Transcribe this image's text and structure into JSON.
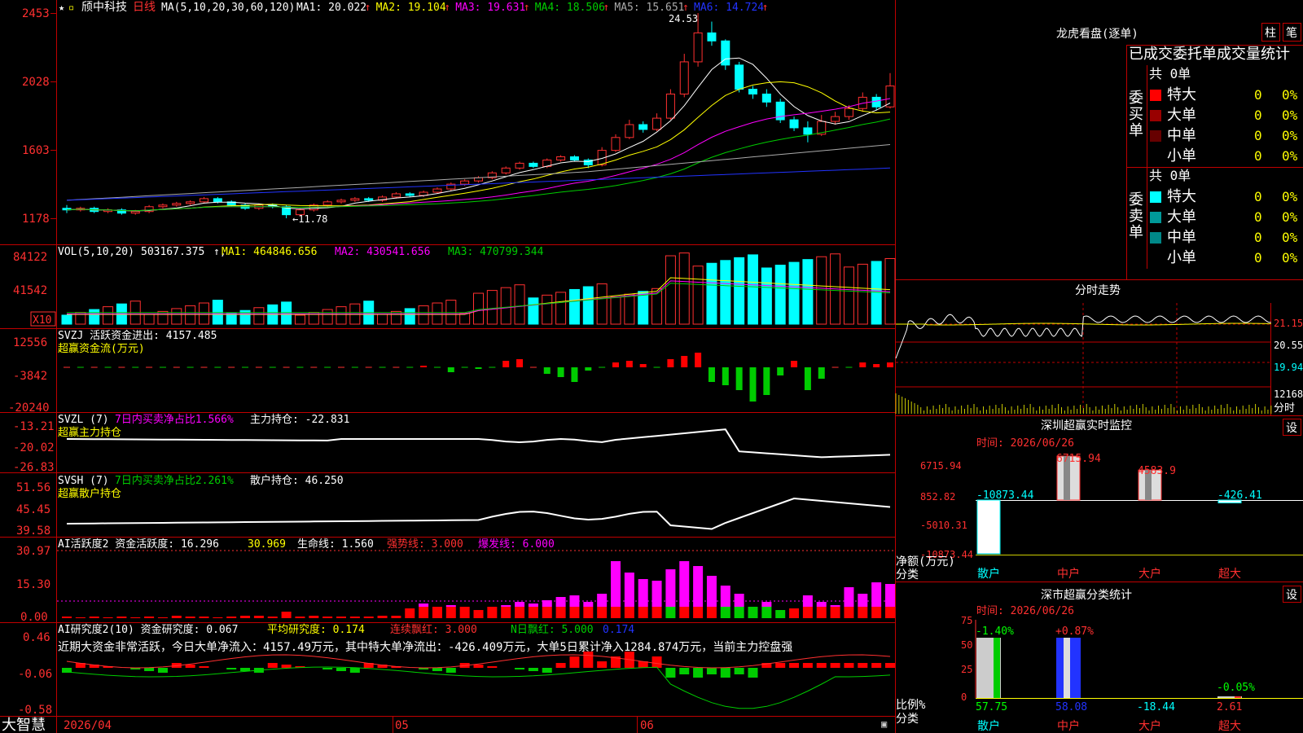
{
  "app": {
    "brand": "大智慧",
    "stock_name": "颀中科技",
    "period_label": "日线"
  },
  "main_chart": {
    "ma_header": "MA(5,10,20,30,60,120)",
    "ma_items": [
      {
        "label": "MA1:",
        "value": "20.022",
        "color": "#ffffff"
      },
      {
        "label": "MA2:",
        "value": "19.104",
        "color": "#ffff00"
      },
      {
        "label": "MA3:",
        "value": "19.631",
        "color": "#ff00ff"
      },
      {
        "label": "MA4:",
        "value": "18.506",
        "color": "#00cc00"
      },
      {
        "label": "MA5:",
        "value": "15.651",
        "color": "#aaaaaa"
      },
      {
        "label": "MA6:",
        "value": "14.724",
        "color": "#2233ff"
      }
    ],
    "y_labels": [
      "2453",
      "2028",
      "1603",
      "1178"
    ],
    "high_label": "24.53",
    "low_label": "←11.78"
  },
  "vol_panel": {
    "header": "VOL(5,10,20)",
    "value": "503167.375",
    "ma1": "MA1: 464846.656",
    "ma2": "MA2: 430541.656",
    "ma3": "MA3: 470799.344",
    "y_labels": [
      "84122",
      "41542"
    ],
    "unit": "X10"
  },
  "svzj_panel": {
    "header": "SVZJ  活跃资金进出: 4157.485",
    "sub": "超赢资金流(万元)",
    "y_labels": [
      "12556",
      "-3842",
      "-20240"
    ]
  },
  "svzl_panel": {
    "header_a": "SVZL (7)",
    "header_b": "7日内买卖净占比1.566%",
    "header_c": "主力持仓: -22.831",
    "sub": "超赢主力持仓",
    "y_labels": [
      "-13.21",
      "-20.02",
      "-26.83"
    ]
  },
  "svsh_panel": {
    "header_a": "SVSH (7)",
    "header_b": "7日内买卖净占比2.261%",
    "header_c": "散户持仓: 46.250",
    "sub": "超赢散户持仓",
    "y_labels": [
      "51.56",
      "45.45",
      "39.58"
    ]
  },
  "ai_active_panel": {
    "header_a": "AI活跃度2 资金活跃度: 16.296",
    "val_b": "30.969",
    "header_c": "生命线: 1.560",
    "header_d": "强势线: 3.000",
    "header_e": "爆发线: 6.000",
    "y_labels": [
      "30.97",
      "15.30",
      "0.00"
    ]
  },
  "ai_research_panel": {
    "header_a": "AI研究度2(10) 资金研究度: 0.067",
    "header_b": "平均研究度: 0.174",
    "header_c": "连续飘红: 3.000",
    "header_d": "N日飘红: 5.000",
    "header_e": "0.174",
    "commentary": "近期大资金非常活跃，今日大单净流入：4157.49万元，其中特大单净流出：-426.409万元，大单5日累计净入1284.874万元，当前主力控盘强",
    "y_labels": [
      "0.46",
      "-0.06",
      "-0.58"
    ]
  },
  "x_axis": {
    "labels": [
      "2026/04",
      "05",
      "06"
    ]
  },
  "dragon_tiger": {
    "title": "龙虎看盘(逐单)",
    "btn_a": "柱",
    "btn_b": "笔",
    "tabs": "已成交委托单成交量统计",
    "buy_side": "委买单",
    "sell_side": "委卖单",
    "buy_total": "共 0单",
    "sell_total": "共 0单",
    "buy_rows": [
      {
        "label": "特大",
        "count": "0",
        "pct": "0%",
        "color": "#ff0000"
      },
      {
        "label": "大单",
        "count": "0",
        "pct": "0%",
        "color": "#990000"
      },
      {
        "label": "中单",
        "count": "0",
        "pct": "0%",
        "color": "#660000"
      },
      {
        "label": "小单",
        "count": "0",
        "pct": "0%",
        "color": "#000000"
      }
    ],
    "sell_rows": [
      {
        "label": "特大",
        "count": "0",
        "pct": "0%",
        "color": "#00ffff"
      },
      {
        "label": "大单",
        "count": "0",
        "pct": "0%",
        "color": "#009999"
      },
      {
        "label": "中单",
        "count": "0",
        "pct": "0%",
        "color": "#008888"
      },
      {
        "label": "小单",
        "count": "0",
        "pct": "0%",
        "color": "#000000"
      }
    ]
  },
  "timeshare": {
    "title": "分时走势",
    "y_labels": [
      "21.15",
      "20.55",
      "19.94"
    ],
    "vol_label": "12168",
    "vol_unit": "分时"
  },
  "sz_monitor": {
    "title": "深圳超赢实时监控",
    "settings": "设",
    "time": "时间: 2026/06/26",
    "y_labels": [
      "6715.94",
      "852.82",
      "-5010.31",
      "-10873.44"
    ],
    "values": [
      "-10873.44",
      "6715.94",
      "4583.9",
      "-426.41"
    ],
    "categories": [
      "散户",
      "中户",
      "大户",
      "超大"
    ],
    "net_label": "净额(万元)",
    "class_label": "分类"
  },
  "sz_classify": {
    "title": "深市超赢分类统计",
    "settings": "设",
    "time": "时间: 2026/06/26",
    "y_labels": [
      "75",
      "50",
      "25",
      "0"
    ],
    "top_values": [
      "-1.40%",
      "+0.87%",
      "",
      "-0.05%"
    ],
    "bottom_values": [
      "57.75",
      "58.08",
      "-18.44",
      "2.61"
    ],
    "categories": [
      "散户",
      "中户",
      "大户",
      "超大"
    ],
    "ratio_label": "比例%",
    "class_label": "分类"
  }
}
